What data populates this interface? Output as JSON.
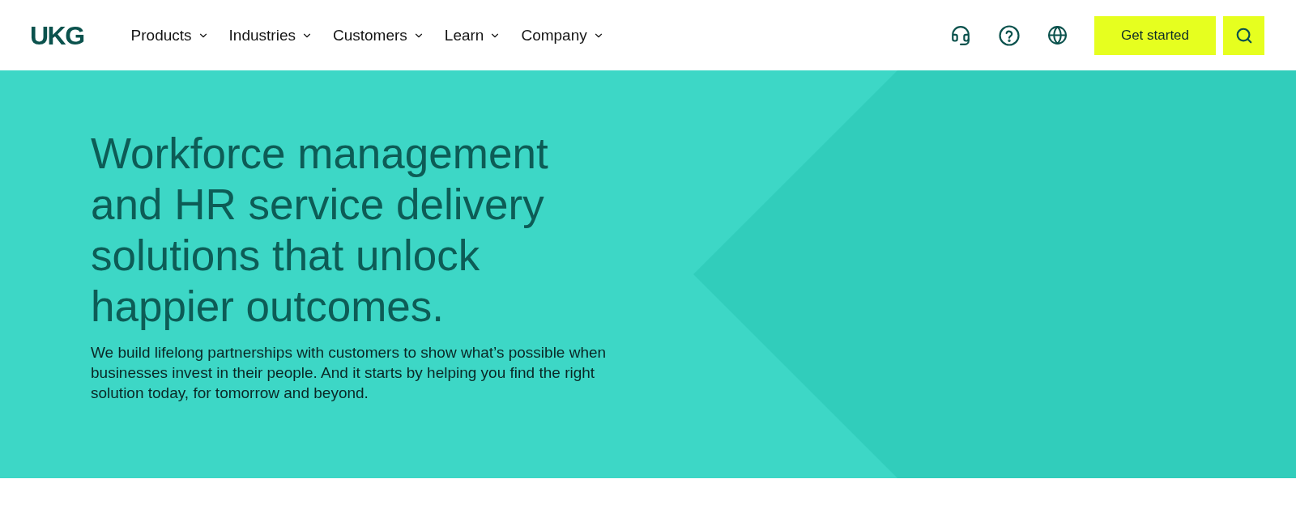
{
  "header": {
    "logo": "UKG",
    "nav": [
      {
        "label": "Products"
      },
      {
        "label": "Industries"
      },
      {
        "label": "Customers"
      },
      {
        "label": "Learn"
      },
      {
        "label": "Company"
      }
    ],
    "cta": "Get started"
  },
  "hero": {
    "heading": "Workforce management and HR service delivery solutions that unlock happier outcomes.",
    "body": "We build lifelong partnerships with customers to show what’s possible when businesses invest in their people. And it starts by helping you find the right solution today, for tomorrow and beyond."
  }
}
